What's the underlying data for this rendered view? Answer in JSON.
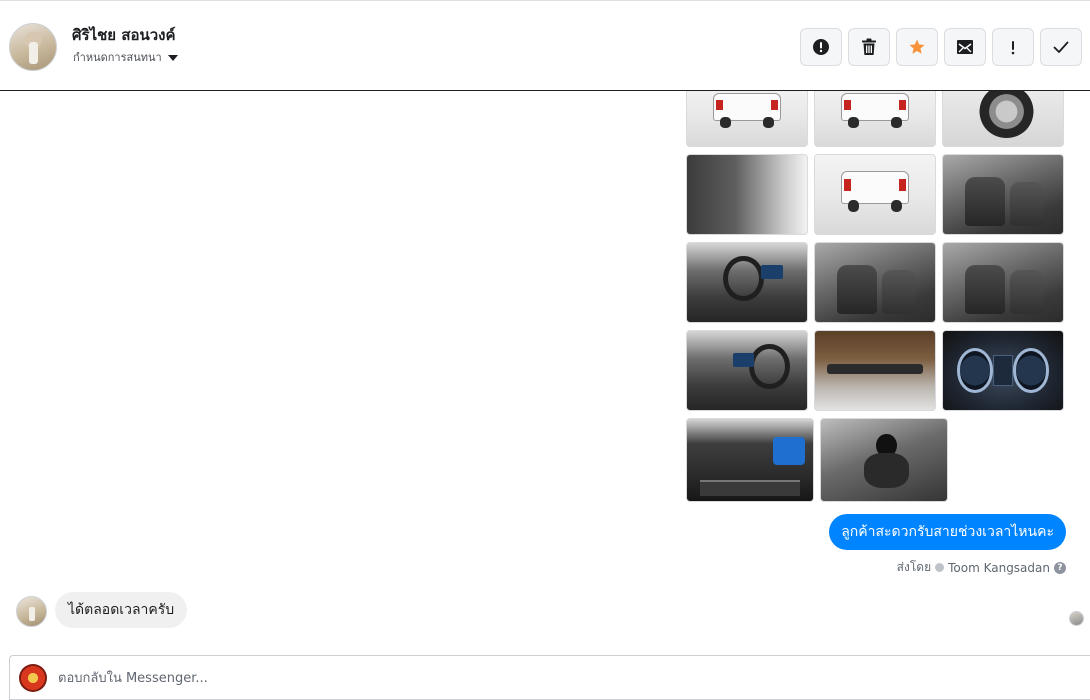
{
  "header": {
    "contact_name": "ศิริไชย สอนวงค์",
    "conversation_settings": "กำหนดการสนทนา",
    "toolbar": [
      {
        "name": "mark-spam-button",
        "icon": "exclamation-circle-icon"
      },
      {
        "name": "delete-button",
        "icon": "trash-icon"
      },
      {
        "name": "star-button",
        "icon": "star-icon",
        "color": "#f7923b"
      },
      {
        "name": "mark-unread-button",
        "icon": "envelope-icon"
      },
      {
        "name": "follow-up-button",
        "icon": "exclamation-icon"
      },
      {
        "name": "mark-done-button",
        "icon": "checkmark-icon"
      }
    ]
  },
  "thread": {
    "photo_attachments": [
      {
        "subject": "truck-rear"
      },
      {
        "subject": "truck-rear"
      },
      {
        "subject": "wheel"
      },
      {
        "subject": "door-panel"
      },
      {
        "subject": "truck-rear-quarter"
      },
      {
        "subject": "interior-seats"
      },
      {
        "subject": "dashboard"
      },
      {
        "subject": "interior-seats"
      },
      {
        "subject": "interior-seats"
      },
      {
        "subject": "dashboard-rear-view"
      },
      {
        "subject": "underbody"
      },
      {
        "subject": "instrument-cluster"
      },
      {
        "subject": "engine-bay"
      },
      {
        "subject": "gear-shifter"
      }
    ],
    "outgoing_message": "ลูกค้าสะดวกรับสายช่วงเวลาไหนคะ",
    "sent_by_label": "ส่งโดย",
    "sent_by_name": "Toom Kangsadan",
    "incoming_message": "ได้ตลอดเวลาครับ"
  },
  "composer": {
    "placeholder": "ตอบกลับใน Messenger..."
  },
  "colors": {
    "messenger_blue": "#0084ff",
    "star_orange": "#f7923b",
    "incoming_bubble": "#f1f0f0"
  }
}
